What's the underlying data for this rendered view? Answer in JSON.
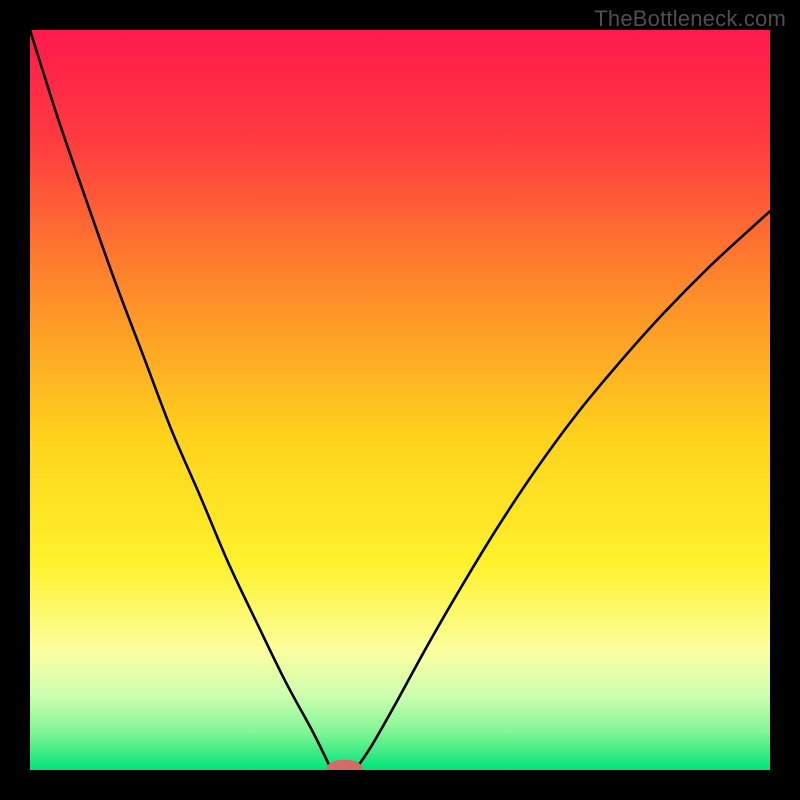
{
  "watermark": "TheBottleneck.com",
  "chart_data": {
    "type": "line",
    "title": "",
    "xlabel": "",
    "ylabel": "",
    "xlim": [
      0,
      100
    ],
    "ylim": [
      0,
      100
    ],
    "grid": false,
    "legend": false,
    "gradient_stops": [
      {
        "offset": 0.0,
        "color": "#ff1a4d"
      },
      {
        "offset": 0.15,
        "color": "#ff3b3f"
      },
      {
        "offset": 0.35,
        "color": "#ff8a2a"
      },
      {
        "offset": 0.55,
        "color": "#ffd21c"
      },
      {
        "offset": 0.72,
        "color": "#fff22b"
      },
      {
        "offset": 0.84,
        "color": "#fbffa0"
      },
      {
        "offset": 0.9,
        "color": "#ccffb0"
      },
      {
        "offset": 0.95,
        "color": "#7ef593"
      },
      {
        "offset": 1.0,
        "color": "#00e47a"
      }
    ],
    "series": [
      {
        "name": "left-branch",
        "x": [
          0,
          3.8,
          7.6,
          11.5,
          15.3,
          19.1,
          23.0,
          26.8,
          30.6,
          34.5,
          38.3,
          40.5
        ],
        "y": [
          100,
          88,
          77,
          66,
          56,
          46,
          37,
          28,
          20,
          12,
          5,
          0.5
        ]
      },
      {
        "name": "right-branch",
        "x": [
          44.3,
          46.3,
          49.7,
          53.7,
          58.2,
          63.0,
          68.3,
          73.8,
          79.6,
          85.6,
          91.8,
          98.1,
          100
        ],
        "y": [
          0.5,
          3.5,
          9.5,
          16.8,
          24.6,
          32.5,
          40.5,
          48.0,
          55.0,
          61.7,
          68.0,
          73.8,
          75.5
        ]
      }
    ],
    "marker": {
      "x": 42.5,
      "y": 0.3,
      "color": "#d46a6a",
      "rx": 2.4,
      "ry": 1.1
    }
  }
}
